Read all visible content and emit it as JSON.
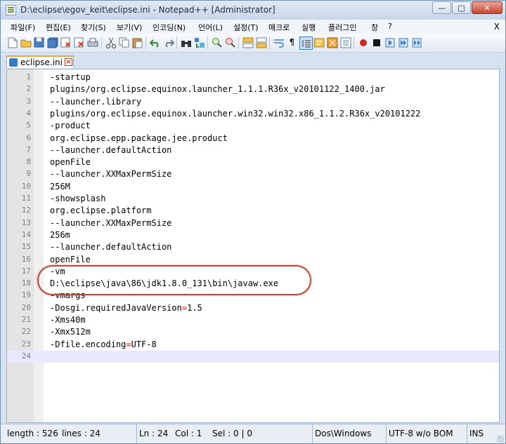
{
  "window": {
    "title": "D:\\eclipse\\egov_keit\\eclipse.ini - Notepad++ [Administrator]"
  },
  "title_buttons": {
    "minimize": "—",
    "maximize": "□",
    "close": "✕"
  },
  "menu": {
    "items": [
      "파일(F)",
      "편집(E)",
      "찾기(S)",
      "보기(V)",
      "인코딩(N)",
      "언어(L)",
      "설정(T)",
      "매크로",
      "실행",
      "플러그인",
      "창",
      "?"
    ],
    "close": "X"
  },
  "tab": {
    "label": "eclipse.ini"
  },
  "editor": {
    "lines": [
      {
        "n": "1",
        "t": "-startup"
      },
      {
        "n": "2",
        "t": "plugins/org.eclipse.equinox.launcher_1.1.1.R36x_v20101122_1400.jar"
      },
      {
        "n": "3",
        "t": "--launcher.library"
      },
      {
        "n": "4",
        "t": "plugins/org.eclipse.equinox.launcher.win32.win32.x86_1.1.2.R36x_v20101222"
      },
      {
        "n": "5",
        "t": "-product"
      },
      {
        "n": "6",
        "t": "org.eclipse.epp.package.jee.product"
      },
      {
        "n": "7",
        "t": "--launcher.defaultAction"
      },
      {
        "n": "8",
        "t": "openFile"
      },
      {
        "n": "9",
        "t": "--launcher.XXMaxPermSize"
      },
      {
        "n": "10",
        "t": "256M"
      },
      {
        "n": "11",
        "t": "-showsplash"
      },
      {
        "n": "12",
        "t": "org.eclipse.platform"
      },
      {
        "n": "13",
        "t": "--launcher.XXMaxPermSize"
      },
      {
        "n": "14",
        "t": "256m"
      },
      {
        "n": "15",
        "t": "--launcher.defaultAction"
      },
      {
        "n": "16",
        "t": "openFile"
      },
      {
        "n": "17",
        "t": "-vm"
      },
      {
        "n": "18",
        "t": "D:\\eclipse\\java\\86\\jdk1.8.0_131\\bin\\javaw.exe"
      },
      {
        "n": "19",
        "t": "-vmargs"
      },
      {
        "n": "20",
        "t": "-Dosgi.requiredJavaVersion=1.5"
      },
      {
        "n": "21",
        "t": "-Xms40m"
      },
      {
        "n": "22",
        "t": "-Xmx512m"
      },
      {
        "n": "23",
        "t": "-Dfile.encoding=UTF-8"
      },
      {
        "n": "24",
        "t": ""
      }
    ],
    "current_line": "24"
  },
  "status": {
    "length": "length : 526",
    "lines": "lines : 24",
    "ln": "Ln : 24",
    "col": "Col : 1",
    "sel": "Sel : 0 | 0",
    "eol": "Dos\\Windows",
    "encoding": "UTF-8 w/o BOM",
    "mode": "INS"
  }
}
